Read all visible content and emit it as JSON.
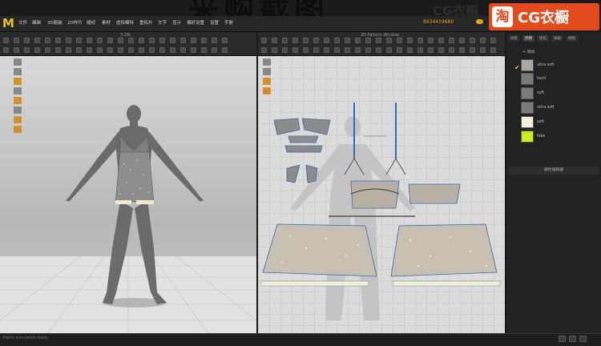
{
  "banner": {
    "title": "采购截图",
    "watermark": "CG衣橱"
  },
  "menu": {
    "items": [
      "文件",
      "编辑",
      "3D服装",
      "2D样片",
      "缝纫",
      "素材",
      "虚拟模特",
      "重拓扑",
      "文字",
      "显示",
      "偏好设置",
      "设置",
      "手册"
    ],
    "serial": "8934419680"
  },
  "brand": {
    "icon_char": "淘",
    "name": "CG衣橱"
  },
  "windows": {
    "view3d_title": "3.26t",
    "view2d_title": "2D Pattern Window"
  },
  "right_panel": {
    "tabs": [
      "场景",
      "织物",
      "纽扣",
      "扣眼",
      "明线"
    ],
    "active_tab": 1,
    "add_label": "+ 增加",
    "fabrics": [
      {
        "name": "ultra soft",
        "color": "#b0a8a0"
      },
      {
        "name": "hard",
        "color": "#7a7a7a"
      },
      {
        "name": "soft",
        "color": "#7a7a7a"
      },
      {
        "name": "ultra soft",
        "color": "#7a7a7a"
      },
      {
        "name": "soft",
        "color": "#f5f0e0"
      },
      {
        "name": "fake",
        "color": "#c8f020"
      }
    ],
    "property_editor": "属性编辑器"
  },
  "status": {
    "text": "Fabric simulation ready"
  },
  "icons": {
    "logo": "marvelous-logo-icon",
    "cloud": "cloud-icon",
    "check": "check-icon"
  }
}
